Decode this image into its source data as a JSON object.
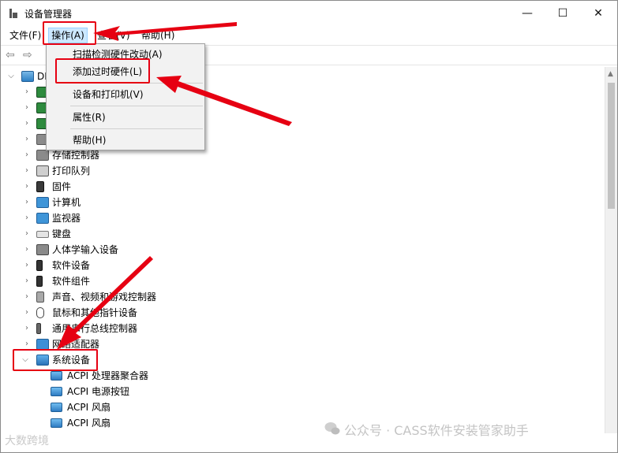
{
  "window": {
    "title": "设备管理器"
  },
  "title_controls": {
    "minimize": "—",
    "maximize": "☐",
    "close": "✕"
  },
  "menubar": {
    "file": "文件(F)",
    "action": "操作(A)",
    "view": "查看(V)",
    "help": "帮助(H)"
  },
  "toolbar": {
    "back": "⇦",
    "forward": "⇨"
  },
  "tree": {
    "root_label": "DI",
    "items": [
      {
        "label": ""
      },
      {
        "label": ""
      },
      {
        "label": ""
      },
      {
        "label": ""
      },
      {
        "label": "存储控制器"
      },
      {
        "label": "打印队列"
      },
      {
        "label": "固件"
      },
      {
        "label": "计算机"
      },
      {
        "label": "监视器"
      },
      {
        "label": "键盘"
      },
      {
        "label": "人体学输入设备"
      },
      {
        "label": "软件设备"
      },
      {
        "label": "软件组件"
      },
      {
        "label": "声音、视频和游戏控制器"
      },
      {
        "label": "鼠标和其他指针设备"
      },
      {
        "label": "通用串行总线控制器"
      },
      {
        "label": "网络适配器"
      },
      {
        "label": "系统设备"
      }
    ],
    "children": [
      {
        "label": "ACPI 处理器聚合器"
      },
      {
        "label": "ACPI 电源按钮"
      },
      {
        "label": "ACPI 风扇"
      },
      {
        "label": "ACPI 风扇"
      }
    ]
  },
  "action_menu": {
    "items": [
      {
        "label": "扫描检测硬件改动(A)"
      },
      {
        "label": "添加过时硬件(L)"
      },
      {
        "label": "设备和打印机(V)"
      },
      {
        "label": "属性(R)"
      },
      {
        "label": "帮助(H)"
      }
    ]
  },
  "watermarks": {
    "right": "公众号 · CASS软件安装管家助手",
    "left": "大数跨境"
  },
  "colors": {
    "highlight": "#e60012",
    "menu_active_bg": "#cce8ff"
  }
}
